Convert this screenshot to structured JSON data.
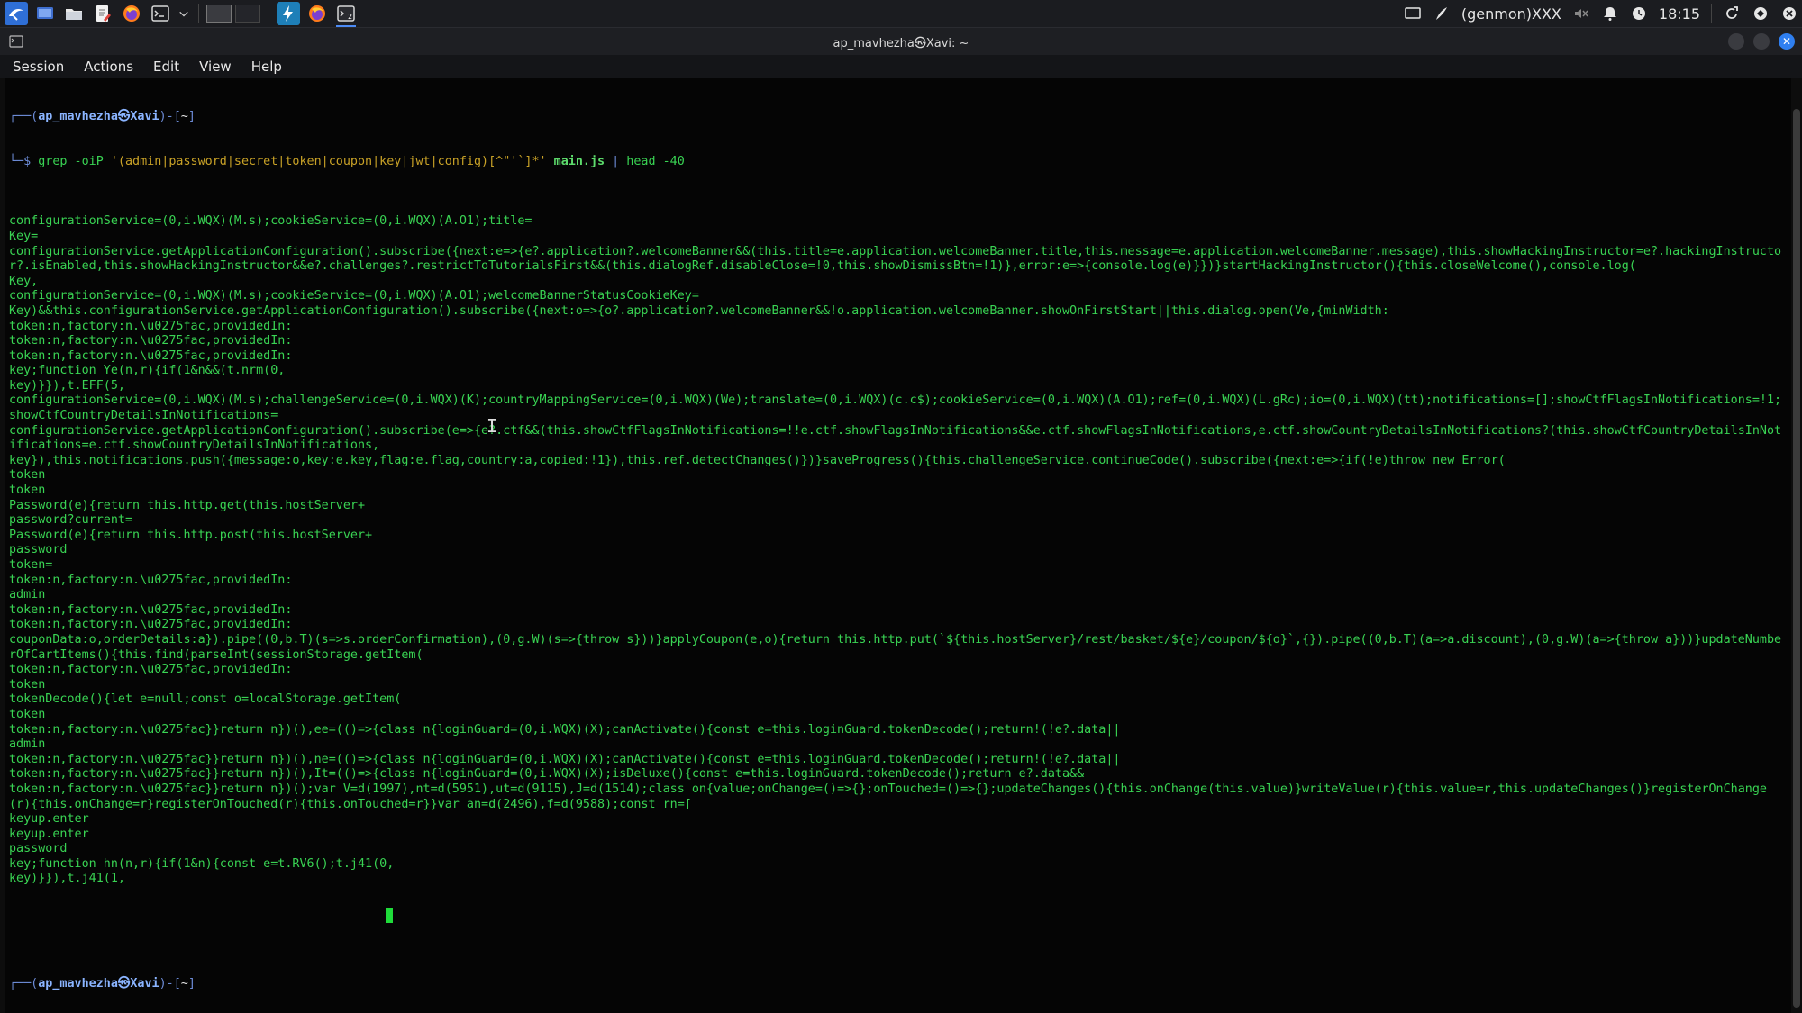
{
  "panel": {
    "indicator_label": "(genmon)XXX",
    "clock": "18:15"
  },
  "window": {
    "title": "ap_mavhezha㉿Xavi: ~",
    "close_glyph": "✕"
  },
  "menu": [
    "Session",
    "Actions",
    "Edit",
    "View",
    "Help"
  ],
  "terminal": {
    "prompt_prefix": "┌──(",
    "prompt_user": "ap_mavhezha㉿Xavi",
    "prompt_mid": ")-[",
    "prompt_dir": "~",
    "prompt_suffix": "]",
    "prompt2": "└─$ ",
    "command": {
      "grep": "grep -oiP ",
      "pattern": "'(admin|password|secret|token|coupon|key|jwt|config)[^\"'`]*'",
      "file": " main.js",
      "pipe": " | ",
      "head": "head -40"
    },
    "output": [
      "configurationService=(0,i.WQX)(M.s);cookieService=(0,i.WQX)(A.O1);title=",
      "Key=",
      "configurationService.getApplicationConfiguration().subscribe({next:e=>{e?.application?.welcomeBanner&&(this.title=e.application.welcomeBanner.title,this.message=e.application.welcomeBanner.message),this.showHackingInstructor=e?.hackingInstructor?.isEnabled,this.showHackingInstructor&&e?.challenges?.restrictToTutorialsFirst&&(this.dialogRef.disableClose=!0,this.showDismissBtn=!1)},error:e=>{console.log(e)}})}startHackingInstructor(){this.closeWelcome(),console.log(",
      "Key,",
      "configurationService=(0,i.WQX)(M.s);cookieService=(0,i.WQX)(A.O1);welcomeBannerStatusCookieKey=",
      "Key)&&this.configurationService.getApplicationConfiguration().subscribe({next:o=>{o?.application?.welcomeBanner&&!o.application.welcomeBanner.showOnFirstStart||this.dialog.open(Ve,{minWidth:",
      "token:n,factory:n.\\u0275fac,providedIn:",
      "token:n,factory:n.\\u0275fac,providedIn:",
      "token:n,factory:n.\\u0275fac,providedIn:",
      "key;function Ye(n,r){if(1&n&&(t.nrm(0,",
      "key)}}),t.EFF(5,",
      "configurationService=(0,i.WQX)(M.s);challengeService=(0,i.WQX)(K);countryMappingService=(0,i.WQX)(We);translate=(0,i.WQX)(c.c$);cookieService=(0,i.WQX)(A.O1);ref=(0,i.WQX)(L.gRc);io=(0,i.WQX)(tt);notifications=[];showCtfFlagsInNotifications=!1;showCtfCountryDetailsInNotifications=",
      "configurationService.getApplicationConfiguration().subscribe(e=>{e?.ctf&&(this.showCtfFlagsInNotifications=!!e.ctf.showFlagsInNotifications&&e.ctf.showFlagsInNotifications,e.ctf.showCountryDetailsInNotifications?(this.showCtfCountryDetailsInNotifications=e.ctf.showCountryDetailsInNotifications,",
      "key}),this.notifications.push({message:o,key:e.key,flag:e.flag,country:a,copied:!1}),this.ref.detectChanges()})}saveProgress(){this.challengeService.continueCode().subscribe({next:e=>{if(!e)throw new Error(",
      "token",
      "token",
      "Password(e){return this.http.get(this.hostServer+",
      "password?current=",
      "Password(e){return this.http.post(this.hostServer+",
      "password",
      "token=",
      "token:n,factory:n.\\u0275fac,providedIn:",
      "admin",
      "token:n,factory:n.\\u0275fac,providedIn:",
      "token:n,factory:n.\\u0275fac,providedIn:",
      "couponData:o,orderDetails:a}).pipe((0,b.T)(s=>s.orderConfirmation),(0,g.W)(s=>{throw s}))}applyCoupon(e,o){return this.http.put(`${this.hostServer}/rest/basket/${e}/coupon/${o}`,{}).pipe((0,b.T)(a=>a.discount),(0,g.W)(a=>{throw a}))}updateNumberOfCartItems(){this.find(parseInt(sessionStorage.getItem(",
      "token:n,factory:n.\\u0275fac,providedIn:",
      "token",
      "tokenDecode(){let e=null;const o=localStorage.getItem(",
      "token",
      "token:n,factory:n.\\u0275fac}}return n})(),ee=(()=>{class n{loginGuard=(0,i.WQX)(X);canActivate(){const e=this.loginGuard.tokenDecode();return!(!e?.data||",
      "admin",
      "token:n,factory:n.\\u0275fac}}return n})(),ne=(()=>{class n{loginGuard=(0,i.WQX)(X);canActivate(){const e=this.loginGuard.tokenDecode();return!(!e?.data||",
      "token:n,factory:n.\\u0275fac}}return n})(),It=(()=>{class n{loginGuard=(0,i.WQX)(X);isDeluxe(){const e=this.loginGuard.tokenDecode();return e?.data&&",
      "token:n,factory:n.\\u0275fac}}return n})();var V=d(1997),nt=d(5951),ut=d(9115),J=d(1514);class on{value;onChange=()=>{};onTouched=()=>{};updateChanges(){this.onChange(this.value)}writeValue(r){this.value=r,this.updateChanges()}registerOnChange(r){this.onChange=r}registerOnTouched(r){this.onTouched=r}}var an=d(2496),f=d(9588);const rn=[",
      "keyup.enter",
      "keyup.enter",
      "password",
      "key;function hn(n,r){if(1&n){const e=t.RV6();t.j41(0,",
      "key)}}),t.j41(1,"
    ]
  }
}
